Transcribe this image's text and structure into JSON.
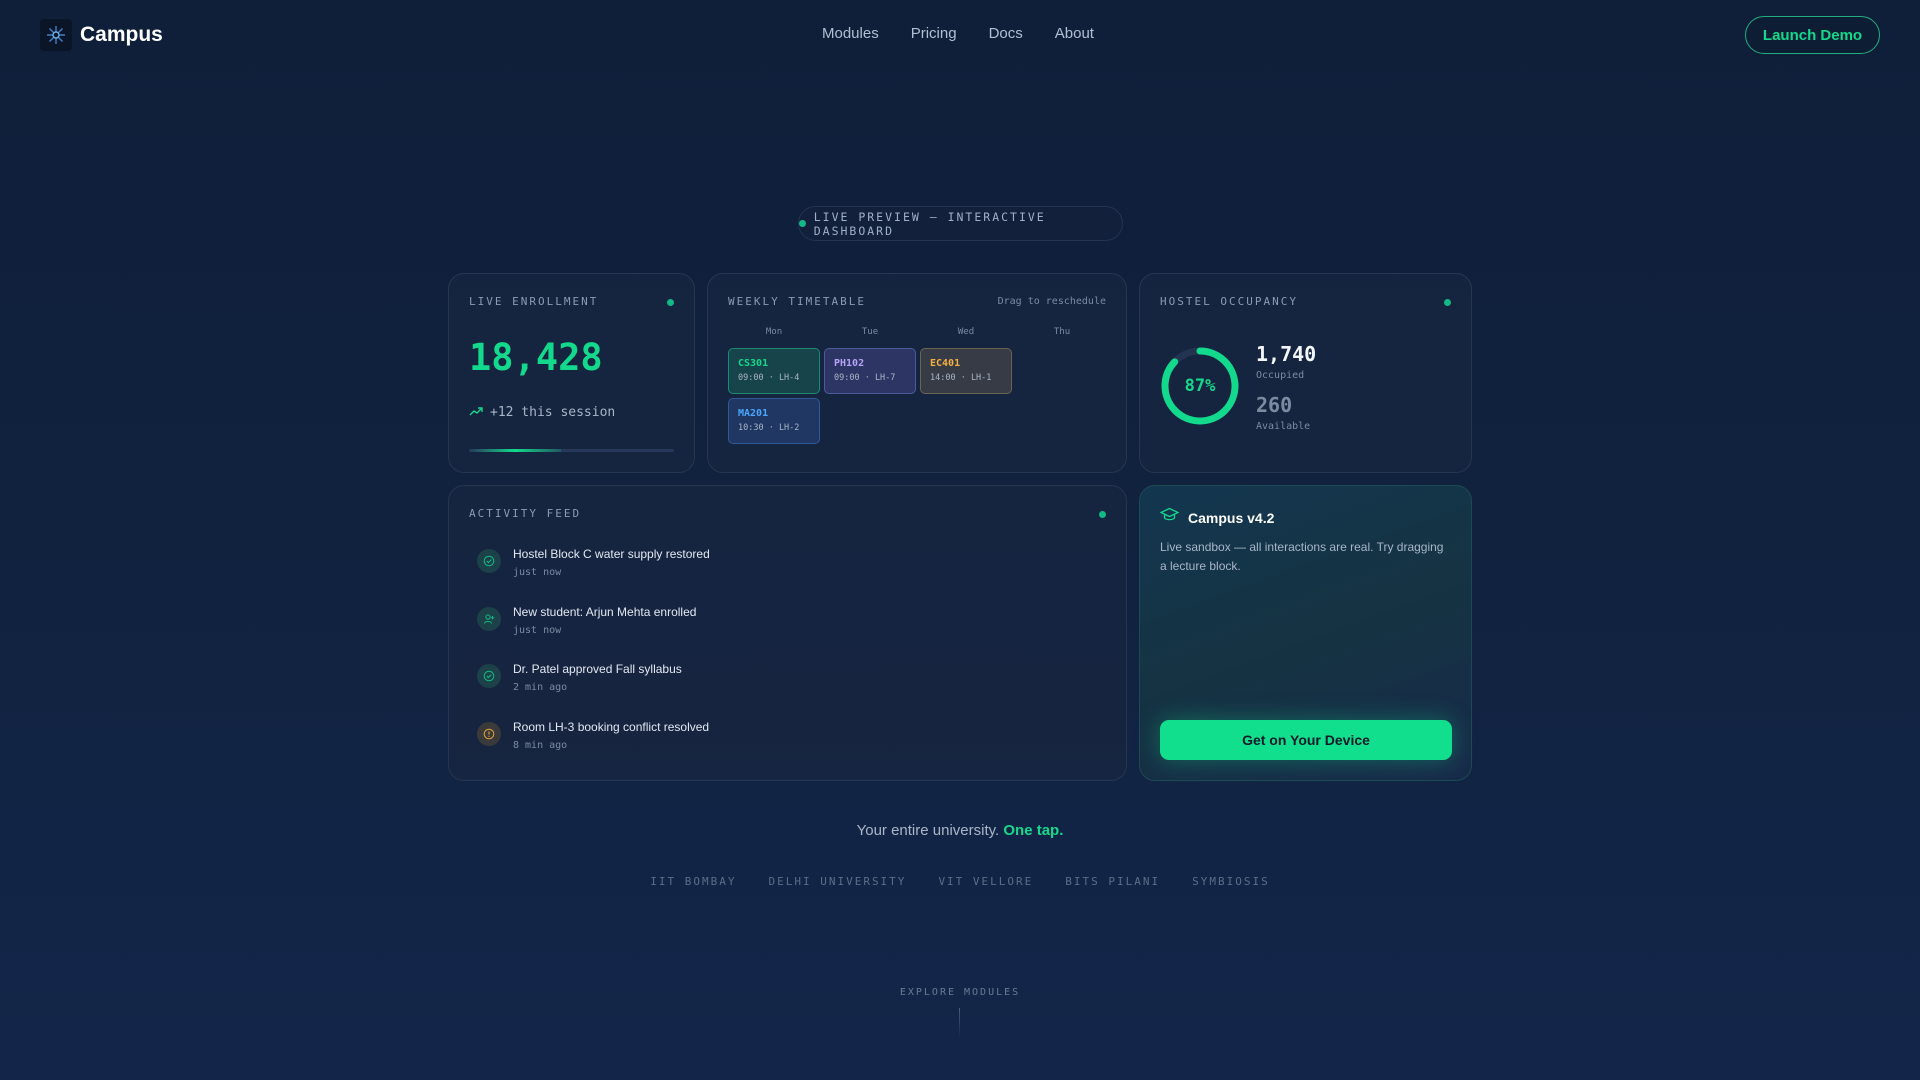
{
  "nav": {
    "brand": "Campus",
    "links": [
      "Modules",
      "Pricing",
      "Docs",
      "About"
    ],
    "cta": "Launch Demo"
  },
  "live_pill": "LIVE PREVIEW — INTERACTIVE DASHBOARD",
  "enrollment": {
    "title": "LIVE ENROLLMENT",
    "value": "18,428",
    "delta": "+12 this session",
    "progress": 0.45
  },
  "timetable": {
    "title": "WEEKLY TIMETABLE",
    "hint": "Drag to reschedule",
    "days": [
      "Mon",
      "Tue",
      "Wed",
      "Thu"
    ],
    "blocks": [
      {
        "code": "CS301",
        "meta": "09:00 · LH-4"
      },
      {
        "code": "PH102",
        "meta": "09:00 · LH-7"
      },
      {
        "code": "EC401",
        "meta": "14:00 · LH-1"
      },
      {
        "code": "MA201",
        "meta": "10:30 · LH-2"
      }
    ]
  },
  "hostel": {
    "title": "HOSTEL OCCUPANCY",
    "percent": "87%",
    "occupancy_fraction": 0.87,
    "occupied": "1,740",
    "occupied_label": "Occupied",
    "available": "260",
    "available_label": "Available"
  },
  "activity": {
    "title": "ACTIVITY FEED",
    "items": [
      {
        "text": "Hostel Block C water supply restored",
        "time": "just now",
        "icon": "check-circle-icon"
      },
      {
        "text": "New student: Arjun Mehta enrolled",
        "time": "just now",
        "icon": "user-add-icon"
      },
      {
        "text": "Dr. Patel approved Fall syllabus",
        "time": "2 min ago",
        "icon": "check-circle-icon"
      },
      {
        "text": "Room LH-3 booking conflict resolved",
        "time": "8 min ago",
        "icon": "alert-circle-icon"
      }
    ]
  },
  "promo": {
    "title": "Campus v4.2",
    "description": "Live sandbox — all interactions are real. Try dragging a lecture block.",
    "cta": "Get on Your Device"
  },
  "tagline": {
    "lead": "Your entire university.",
    "emphasis": "One tap."
  },
  "universities": [
    "IIT BOMBAY",
    "DELHI UNIVERSITY",
    "VIT VELLORE",
    "BITS PILANI",
    "SYMBIOSIS"
  ],
  "explore": "EXPLORE MODULES",
  "colors": {
    "accent": "#12d98b",
    "background": "#11223f",
    "card": "#172640"
  }
}
